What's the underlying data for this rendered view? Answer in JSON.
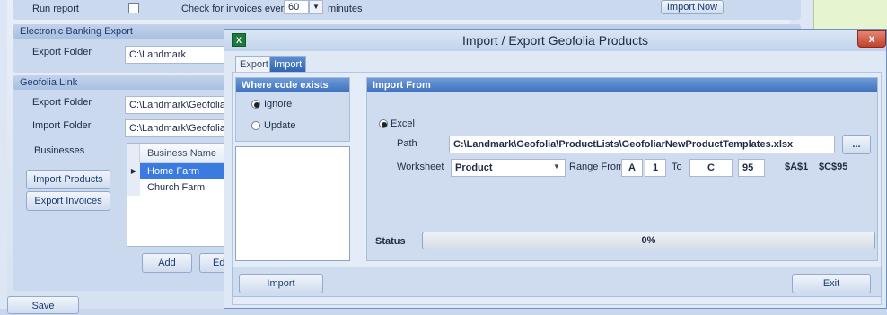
{
  "background": {
    "run_report_label": "Run report",
    "check_invoices_prefix": "Check for invoices every",
    "check_interval": "60",
    "minutes_label": "minutes",
    "import_now_button": "Import Now",
    "electronic_banking": {
      "header": "Electronic Banking Export",
      "export_folder_label": "Export Folder",
      "export_folder_value": "C:\\Landmark"
    },
    "geofolia_link": {
      "header": "Geofolia Link",
      "export_folder_label": "Export Folder",
      "export_folder_value": "C:\\Landmark\\Geofolia\\",
      "import_folder_label": "Import Folder",
      "import_folder_value": "C:\\Landmark\\Geofolia\\",
      "businesses_label": "Businesses",
      "grid_header": "Business Name",
      "businesses": [
        "Home Farm",
        "Church Farm"
      ],
      "import_products_button": "Import Products",
      "export_invoices_button": "Export Invoices",
      "add_button": "Add",
      "edit_button_partial": "Ed"
    },
    "save_button": "Save"
  },
  "dialog": {
    "title": "Import / Export Geofolia Products",
    "close_glyph": "x",
    "app_icon_glyph": "X",
    "tabs": [
      {
        "label": "Export",
        "active": false
      },
      {
        "label": "Import",
        "active": true
      }
    ],
    "where_code_exists": {
      "header": "Where code exists",
      "options": [
        {
          "label": "Ignore",
          "selected": true
        },
        {
          "label": "Update",
          "selected": false
        }
      ]
    },
    "import_from": {
      "header": "Import From",
      "source_option": "Excel",
      "path_label": "Path",
      "path_value": "C:\\Landmark\\Geofolia\\ProductLists\\GeofoliarNewProductTemplates.xlsx",
      "browse_button": "...",
      "worksheet_label": "Worksheet",
      "worksheet_value": "Product",
      "range_from_label": "Range From",
      "range_from_col": "A",
      "range_from_row": "1",
      "to_label": "To",
      "range_to_col": "C",
      "range_to_row": "95",
      "range_start_ref": "$A$1",
      "range_end_ref": "$C$95",
      "status_label": "Status",
      "status_value": "0%"
    },
    "import_button": "Import",
    "exit_button": "Exit"
  }
}
